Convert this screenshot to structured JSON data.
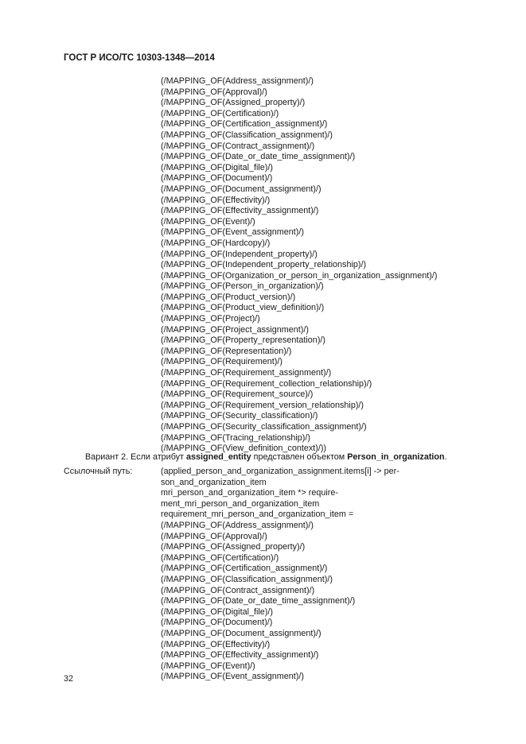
{
  "header": {
    "title": "ГОСТ Р ИСО/ТС 10303-1348—2014"
  },
  "list1": [
    "(/MAPPING_OF(Address_assignment)/)",
    "(/MAPPING_OF(Approval)/)",
    "(/MAPPING_OF(Assigned_property)/)",
    "(/MAPPING_OF(Certification)/)",
    "(/MAPPING_OF(Certification_assignment)/)",
    "(/MAPPING_OF(Classification_assignment)/)",
    "(/MAPPING_OF(Contract_assignment)/)",
    "(/MAPPING_OF(Date_or_date_time_assignment)/)",
    "(/MAPPING_OF(Digital_file)/)",
    "(/MAPPING_OF(Document)/)",
    "(/MAPPING_OF(Document_assignment)/)",
    "(/MAPPING_OF(Effectivity)/)",
    "(/MAPPING_OF(Effectivity_assignment)/)",
    "(/MAPPING_OF(Event)/)",
    "(/MAPPING_OF(Event_assignment)/)",
    "(/MAPPING_OF(Hardcopy)/)",
    "(/MAPPING_OF(Independent_property)/)",
    "(/MAPPING_OF(Independent_property_relationship)/)",
    "(/MAPPING_OF(Organization_or_person_in_organization_assignment)/)",
    "(/MAPPING_OF(Person_in_organization)/)",
    "(/MAPPING_OF(Product_version)/)",
    "(/MAPPING_OF(Product_view_definition)/)",
    "(/MAPPING_OF(Project)/)",
    "(/MAPPING_OF(Project_assignment)/)",
    "(/MAPPING_OF(Property_representation)/)",
    "(/MAPPING_OF(Representation)/)",
    "(/MAPPING_OF(Requirement)/)",
    "(/MAPPING_OF(Requirement_assignment)/)",
    "(/MAPPING_OF(Requirement_collection_relationship)/)",
    "(/MAPPING_OF(Requirement_source)/)",
    "(/MAPPING_OF(Requirement_version_relationship)/)",
    "(/MAPPING_OF(Security_classification)/)",
    "(/MAPPING_OF(Security_classification_assignment)/)",
    "(/MAPPING_OF(Tracing_relationship)/)",
    "(/MAPPING_OF(View_definition_context)/))"
  ],
  "variant": {
    "prefix": "Вариант 2.  Если атрибут ",
    "attribute": "assigned_entity",
    "middle": " представлен объектом ",
    "entity": "Person_in_organization",
    "suffix": "."
  },
  "reference_path": {
    "label": "Ссылочный путь:",
    "lines": [
      "(applied_person_and_organization_assignment.items[i] -> per-",
      "son_and_organization_item",
      "mri_person_and_organization_item *> require-",
      "ment_mri_person_and_organization_item",
      "requirement_mri_person_and_organization_item =",
      "(/MAPPING_OF(Address_assignment)/)",
      "(/MAPPING_OF(Approval)/)",
      "(/MAPPING_OF(Assigned_property)/)",
      "(/MAPPING_OF(Certification)/)",
      "(/MAPPING_OF(Certification_assignment)/)",
      "(/MAPPING_OF(Classification_assignment)/)",
      "(/MAPPING_OF(Contract_assignment)/)",
      "(/MAPPING_OF(Date_or_date_time_assignment)/)",
      "(/MAPPING_OF(Digital_file)/)",
      "(/MAPPING_OF(Document)/)",
      "(/MAPPING_OF(Document_assignment)/)",
      "(/MAPPING_OF(Effectivity)/)",
      "(/MAPPING_OF(Effectivity_assignment)/)",
      "(/MAPPING_OF(Event)/)",
      "(/MAPPING_OF(Event_assignment)/)"
    ]
  },
  "footer": {
    "page_number": "32"
  }
}
